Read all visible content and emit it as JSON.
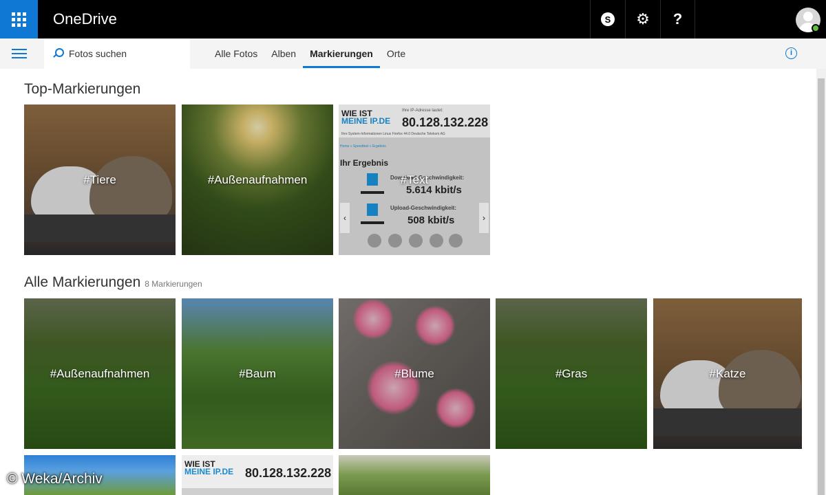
{
  "app": {
    "title": "OneDrive"
  },
  "header": {
    "skype_glyph": "S",
    "settings_glyph": "⚙",
    "help_glyph": "?"
  },
  "search": {
    "placeholder": "Fotos suchen"
  },
  "tabs": [
    {
      "label": "Alle Fotos",
      "active": false
    },
    {
      "label": "Alben",
      "active": false
    },
    {
      "label": "Markierungen",
      "active": true
    },
    {
      "label": "Orte",
      "active": false
    }
  ],
  "info_glyph": "i",
  "top_section": {
    "heading": "Top-Markierungen",
    "tiles": [
      {
        "label": "#Tiere",
        "image": "cats"
      },
      {
        "label": "#Außenaufnahmen",
        "image": "sun"
      },
      {
        "label": "#Text",
        "image": "screenshot"
      }
    ]
  },
  "all_section": {
    "heading": "Alle Markierungen",
    "count": "8 Markierungen",
    "tiles": [
      {
        "label": "#Außenaufnahmen",
        "image": "grass"
      },
      {
        "label": "#Baum",
        "image": "tree"
      },
      {
        "label": "#Blume",
        "image": "blossom"
      },
      {
        "label": "#Gras",
        "image": "grass"
      },
      {
        "label": "#Katze",
        "image": "cats"
      }
    ]
  },
  "screenshot_tile": {
    "logo_line1": "WIE IST",
    "logo_line2": "MEINE IP.DE",
    "ip_caption": "Ihre IP-Adresse lautet:",
    "ip": "80.128.132.228",
    "meta": "Ihre System-Informationen  Linux  Firefox 44.0  Deutsche Telekom AG",
    "crumb": "Home » Speedtest » Ergebnis",
    "result_heading": "Ihr Ergebnis",
    "download_label": "Download-Geschwindigkeit:",
    "download_value": "5.614 kbit/s",
    "upload_label": "Upload-Geschwindigkeit:",
    "upload_value": "508 kbit/s"
  },
  "watermark": "© Weka/Archiv",
  "colors": {
    "accent": "#0f78d4",
    "topbar": "#000000"
  }
}
